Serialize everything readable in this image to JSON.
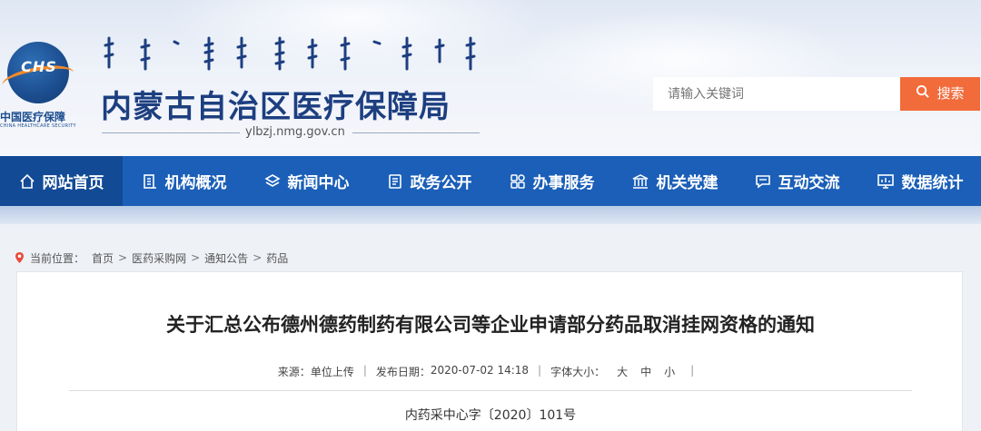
{
  "header": {
    "logo_text": "CHS",
    "logo_cn": "中国医疗保障",
    "logo_en": "CHINA HEALTHCARE SECURITY",
    "title": "内蒙古自治区医疗保障局",
    "url": "ylbzj.nmg.gov.cn"
  },
  "search": {
    "placeholder": "请输入关键词",
    "button_label": "搜索"
  },
  "nav": {
    "items": [
      {
        "label": "网站首页",
        "icon": "home-icon"
      },
      {
        "label": "机构概况",
        "icon": "building-icon"
      },
      {
        "label": "新闻中心",
        "icon": "layers-icon"
      },
      {
        "label": "政务公开",
        "icon": "document-icon"
      },
      {
        "label": "办事服务",
        "icon": "grid-icon"
      },
      {
        "label": "机关党建",
        "icon": "government-icon"
      },
      {
        "label": "互动交流",
        "icon": "chat-icon"
      },
      {
        "label": "数据统计",
        "icon": "monitor-chart-icon"
      }
    ]
  },
  "breadcrumb": {
    "prefix": "当前位置：",
    "items": [
      "首页",
      "医药采购网",
      "通知公告",
      "药品"
    ],
    "separator": ">"
  },
  "article": {
    "title": "关于汇总公布德州德药制药有限公司等企业申请部分药品取消挂网资格的通知",
    "source_label": "来源：",
    "source": "单位上传",
    "date_label": "发布日期：",
    "date": "2020-07-02 14:18",
    "fontsize_label": "字体大小：",
    "fontsize_large": "大",
    "fontsize_medium": "中",
    "fontsize_small": "小",
    "doc_number": "内药采中心字〔2020〕101号"
  },
  "colors": {
    "nav_bg": "#1b5fb8",
    "nav_active": "#124a96",
    "search_button": "#f26b3a",
    "title_blue": "#1d3f80"
  }
}
